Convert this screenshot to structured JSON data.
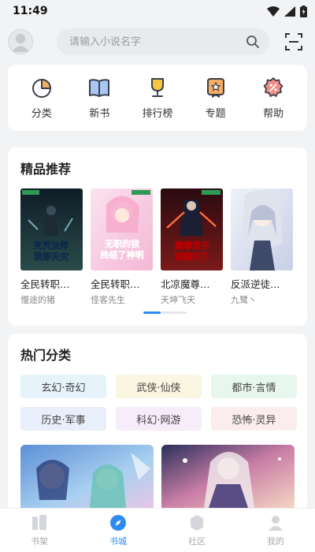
{
  "status": {
    "time": "11:49"
  },
  "search": {
    "placeholder": "请输入小说名字"
  },
  "quick_links": [
    {
      "label": "分类",
      "icon": "pie-chart-icon"
    },
    {
      "label": "新书",
      "icon": "book-icon"
    },
    {
      "label": "排行榜",
      "icon": "trophy-icon"
    },
    {
      "label": "专题",
      "icon": "ribbon-icon"
    },
    {
      "label": "帮助",
      "icon": "help-badge-icon"
    }
  ],
  "featured": {
    "title": "精品推荐",
    "books": [
      {
        "title": "全民转职…",
        "author": "慢途的猪",
        "cover_text": "死灵法师 我即天灾"
      },
      {
        "title": "全民转职…",
        "author": "怪客先生",
        "cover_text": "无职的我 终结了神明"
      },
      {
        "title": "北凉魔尊…",
        "author": "天坤飞天",
        "cover_text": "魔尊世子 剑镇天下"
      },
      {
        "title": "反派逆徒…",
        "author": "九鹭丶",
        "cover_text": ""
      }
    ],
    "pager": {
      "active": 0,
      "count": 2
    }
  },
  "hot_categories": {
    "title": "热门分类",
    "items": [
      {
        "label": "玄幻·奇幻",
        "bg": "#e6f3fb"
      },
      {
        "label": "武侠·仙侠",
        "bg": "#fbf6e2"
      },
      {
        "label": "都市·言情",
        "bg": "#e8f7ee"
      },
      {
        "label": "历史·军事",
        "bg": "#e9eefb"
      },
      {
        "label": "科幻·网游",
        "bg": "#f6ecfa"
      },
      {
        "label": "恐怖·灵异",
        "bg": "#fbecee"
      }
    ]
  },
  "tabbar": [
    {
      "label": "书架",
      "icon": "bookshelf-icon",
      "active": false
    },
    {
      "label": "书城",
      "icon": "compass-icon",
      "active": true
    },
    {
      "label": "社区",
      "icon": "community-icon",
      "active": false
    },
    {
      "label": "我的",
      "icon": "profile-icon",
      "active": false
    }
  ],
  "colors": {
    "accent": "#2e8cf0",
    "icon_outline": "#3a3f4b",
    "icon_fill": "#f6ad63"
  }
}
